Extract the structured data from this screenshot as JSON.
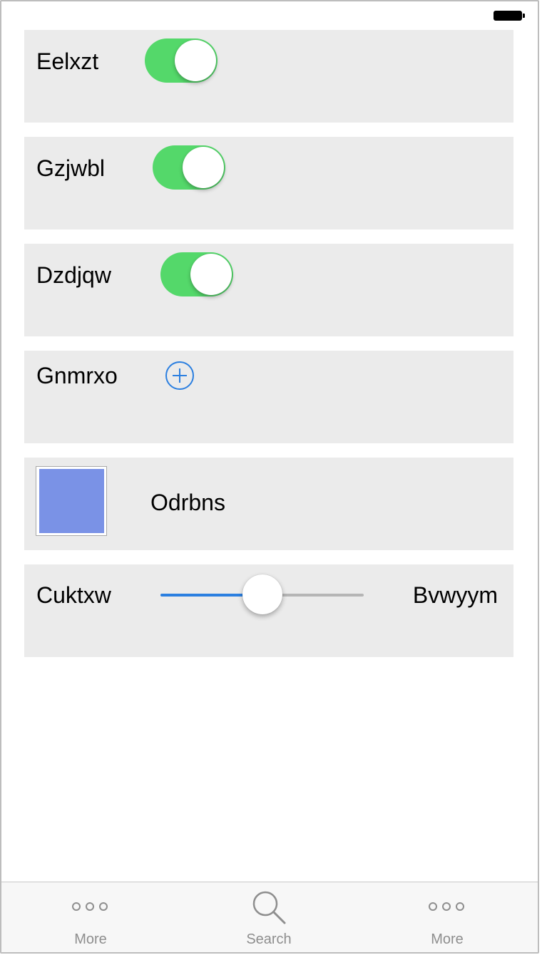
{
  "rows": {
    "toggle1": {
      "label": "Eelxzt",
      "on": true
    },
    "toggle2": {
      "label": "Gzjwbl",
      "on": true
    },
    "toggle3": {
      "label": "Dzdjqw",
      "on": true
    },
    "add": {
      "label": "Gnmrxo"
    },
    "color": {
      "label": "Odrbns",
      "swatch_color": "#7a92e6"
    },
    "slider": {
      "min_label": "Cuktxw",
      "max_label": "Bvwyym",
      "value": 0.5
    }
  },
  "tabbar": {
    "tabs": [
      {
        "label": "More",
        "icon": "more-dots-icon"
      },
      {
        "label": "Search",
        "icon": "search-icon"
      },
      {
        "label": "More",
        "icon": "more-dots-icon"
      }
    ]
  },
  "colors": {
    "toggle_on": "#54d86a",
    "accent": "#2b7fe0",
    "row_background": "#ebebeb",
    "tab_inactive": "#8e8e8e"
  }
}
